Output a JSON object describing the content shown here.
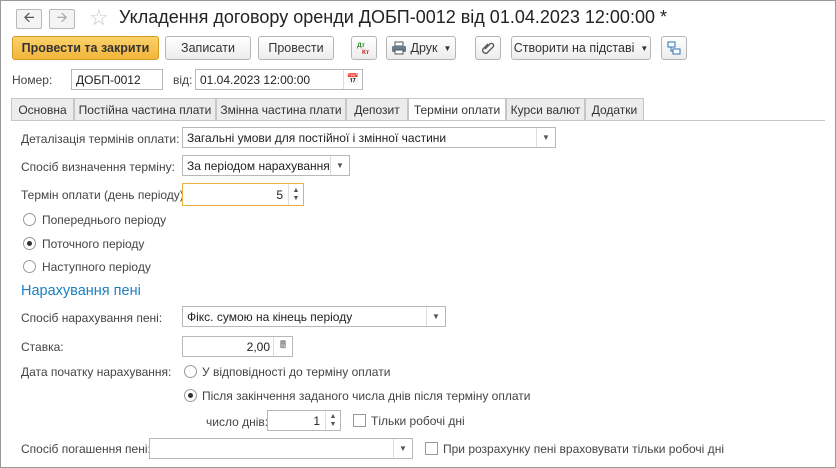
{
  "window": {
    "title": "Укладення договору оренди ДОБП-0012 від 01.04.2023 12:00:00 *"
  },
  "toolbar": {
    "post_close": "Провести та закрити",
    "save": "Записати",
    "post": "Провести",
    "print": "Друк",
    "create_based": "Створити на підставі"
  },
  "header": {
    "number_label": "Номер:",
    "number_value": "ДОБП-0012",
    "date_label": "від:",
    "date_value": "01.04.2023 12:00:00"
  },
  "tabs": [
    {
      "label": "Основна"
    },
    {
      "label": "Постійна частина плати"
    },
    {
      "label": "Змінна частина плати"
    },
    {
      "label": "Депозит"
    },
    {
      "label": "Терміни оплати"
    },
    {
      "label": "Курси валют"
    },
    {
      "label": "Додатки"
    }
  ],
  "payment": {
    "detail_label": "Деталізація термінів оплати:",
    "detail_value": "Загальні умови для постійної і змінної частини",
    "method_label": "Спосіб визначення терміну:",
    "method_value": "За періодом нарахування",
    "term_label": "Термін оплати (день періоду):",
    "term_value": "5",
    "radio_prev": "Попереднього періоду",
    "radio_current": "Поточного періоду",
    "radio_next": "Наступного періоду"
  },
  "penalty": {
    "section_title": "Нарахування пені",
    "method_label": "Спосіб нарахування пені:",
    "method_value": "Фікс. сумою на кінець періоду",
    "rate_label": "Ставка:",
    "rate_value": "2,00",
    "start_label": "Дата початку нарахування:",
    "radio_according": "У відповідності до терміну оплати",
    "radio_after": "Після закінчення заданого числа днів після терміну оплати",
    "days_label": "число днів:",
    "days_value": "1",
    "workdays_only": "Тільки робочі дні",
    "repay_label": "Спосіб погашення пені:",
    "repay_value": "",
    "consider_workdays": "При розрахунку пені враховувати тільки робочі дні"
  }
}
